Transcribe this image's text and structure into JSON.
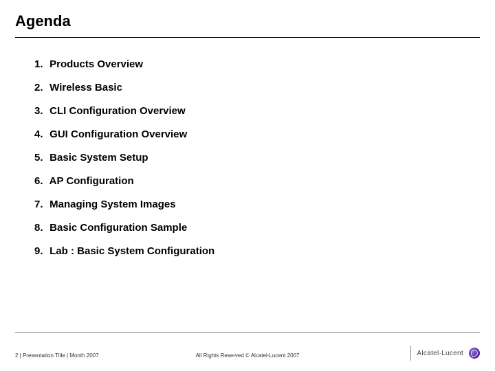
{
  "title": "Agenda",
  "items": [
    "Products Overview",
    "Wireless Basic",
    "CLI Configuration Overview",
    "GUI Configuration Overview",
    "Basic System Setup",
    "AP Configuration",
    "Managing System Images",
    "Basic Configuration Sample",
    "Lab : Basic System Configuration"
  ],
  "footer": {
    "left": "2 | Presentation Title | Month 2007",
    "center": "All Rights Reserved © Alcatel-Lucent 2007",
    "logo_text": "Alcatel·Lucent"
  }
}
